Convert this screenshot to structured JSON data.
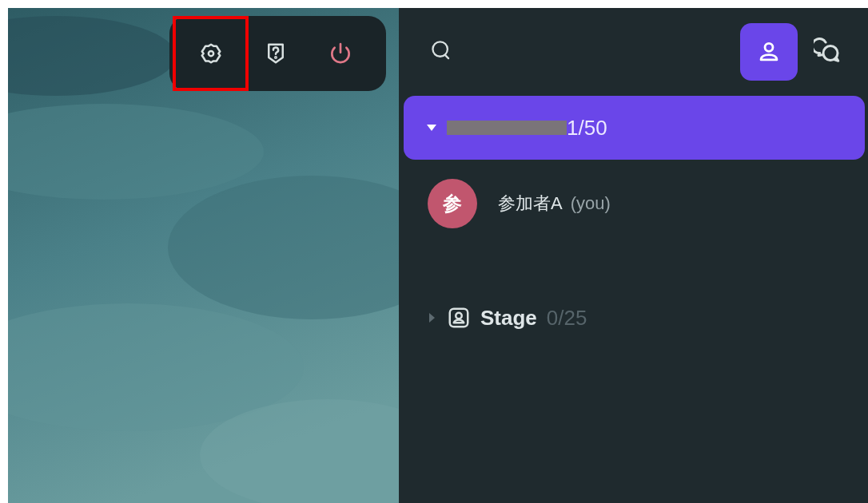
{
  "toolbar": {
    "buttons": [
      {
        "kind": "settings",
        "highlighted": true
      },
      {
        "kind": "help",
        "highlighted": false
      },
      {
        "kind": "power",
        "highlighted": false
      }
    ]
  },
  "sidebar": {
    "tabs": [
      {
        "kind": "people",
        "selected": true
      },
      {
        "kind": "chat",
        "selected": false
      }
    ],
    "groups": [
      {
        "kind": "room",
        "redacted_name": true,
        "count": "1/50",
        "expanded": true,
        "members": [
          {
            "avatar": "参",
            "name": "参加者A",
            "suffix": "(you)",
            "color": "#c1566e"
          }
        ]
      },
      {
        "kind": "stage",
        "label": "Stage",
        "count": "0/25",
        "expanded": false
      }
    ]
  }
}
